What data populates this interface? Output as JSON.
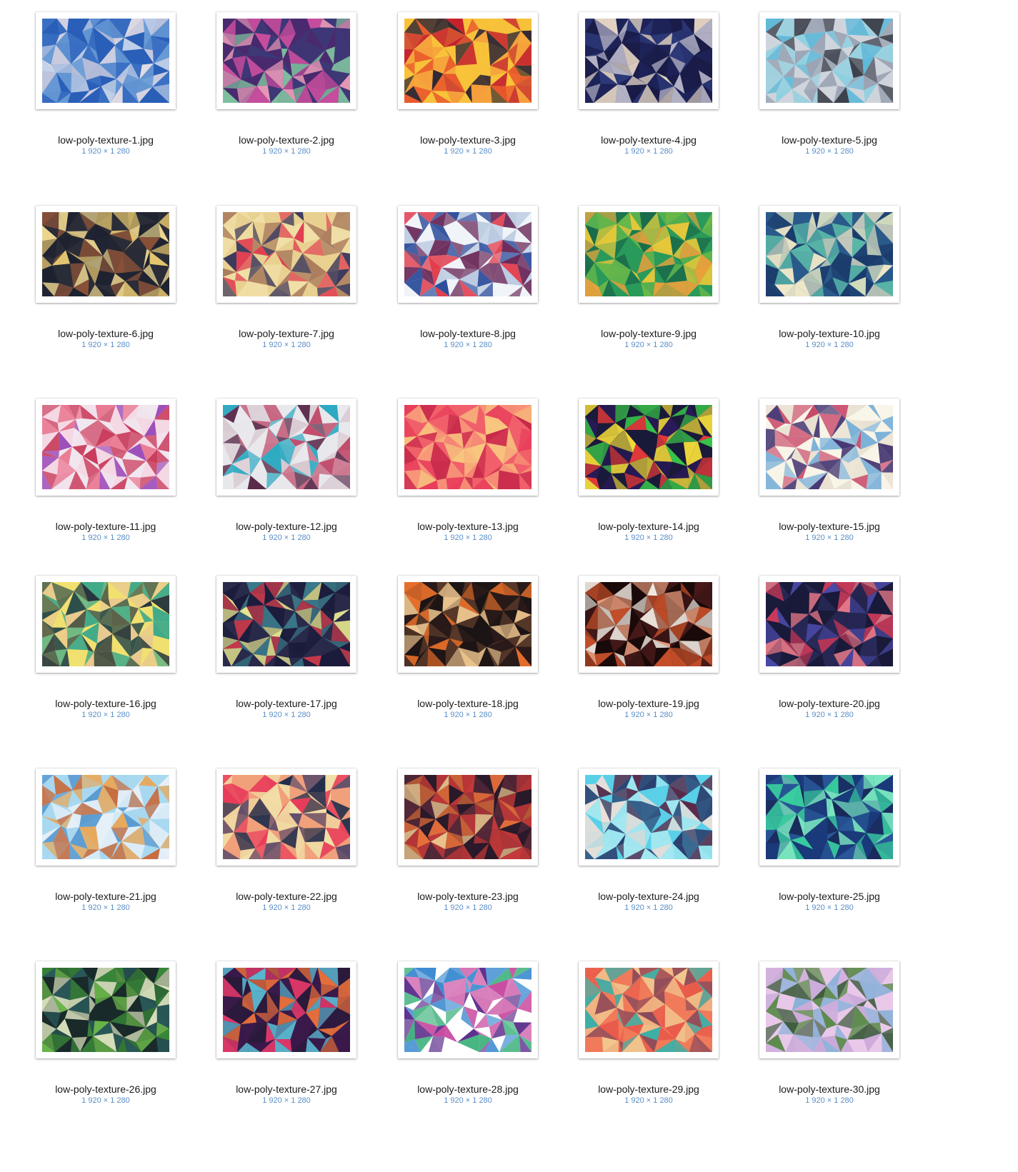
{
  "files": [
    {
      "name": "low-poly-texture-1.jpg",
      "dims": "1 920 × 1 280",
      "palette": [
        "#2a5fb8",
        "#6fa0d8",
        "#c9d7ea",
        "#e8e0e6",
        "#3d72c4"
      ]
    },
    {
      "name": "low-poly-texture-2.jpg",
      "dims": "1 920 × 1 280",
      "palette": [
        "#4a2a6e",
        "#c94f9e",
        "#7fc4a0",
        "#e89bb8",
        "#3b3a78"
      ]
    },
    {
      "name": "low-poly-texture-3.jpg",
      "dims": "1 920 × 1 280",
      "palette": [
        "#f7c23a",
        "#e8502a",
        "#c41f2f",
        "#2e2534",
        "#f59a3c"
      ]
    },
    {
      "name": "low-poly-texture-4.jpg",
      "dims": "1 920 × 1 280",
      "palette": [
        "#1d2358",
        "#2d3a7a",
        "#b8b6c8",
        "#e8d8c4",
        "#1a1b45"
      ]
    },
    {
      "name": "low-poly-texture-5.jpg",
      "dims": "1 920 × 1 280",
      "palette": [
        "#cfd4dc",
        "#3a3f4a",
        "#5fb9d8",
        "#8fd0e0",
        "#9aa3b3"
      ]
    },
    {
      "name": "low-poly-texture-6.jpg",
      "dims": "1 920 × 1 280",
      "palette": [
        "#2a2d38",
        "#e8c870",
        "#8a5238",
        "#1e2230",
        "#f0d890"
      ]
    },
    {
      "name": "low-poly-texture-7.jpg",
      "dims": "1 920 × 1 280",
      "palette": [
        "#e8d090",
        "#33305a",
        "#e03a50",
        "#a87a5c",
        "#f0e0a8"
      ]
    },
    {
      "name": "low-poly-texture-8.jpg",
      "dims": "1 920 × 1 280",
      "palette": [
        "#f0f4f8",
        "#2a4a9a",
        "#b8c8e0",
        "#6a2a5a",
        "#e03a4a"
      ]
    },
    {
      "name": "low-poly-texture-9.jpg",
      "dims": "1 920 × 1 280",
      "palette": [
        "#2a9a5a",
        "#e8c83a",
        "#6ab84a",
        "#1a6a4a",
        "#f0a03a"
      ]
    },
    {
      "name": "low-poly-texture-10.jpg",
      "dims": "1 920 × 1 280",
      "palette": [
        "#2a5a8a",
        "#f0e8c8",
        "#5ab8a8",
        "#1a3a6a",
        "#d8e0c0"
      ]
    },
    {
      "name": "low-poly-texture-11.jpg",
      "dims": "1 920 × 1 280",
      "palette": [
        "#f4d8e4",
        "#c83a5a",
        "#9a4ab8",
        "#f0e8f0",
        "#e8708a"
      ]
    },
    {
      "name": "low-poly-texture-12.jpg",
      "dims": "1 920 × 1 280",
      "palette": [
        "#e8e8ec",
        "#2aa8c0",
        "#5a2a4a",
        "#d8c8d0",
        "#c04a6a"
      ]
    },
    {
      "name": "low-poly-texture-13.jpg",
      "dims": "1 920 × 1 280",
      "palette": [
        "#f0606a",
        "#f8c880",
        "#e83a5a",
        "#f89a7a",
        "#c82a4a"
      ]
    },
    {
      "name": "low-poly-texture-14.jpg",
      "dims": "1 920 × 1 280",
      "palette": [
        "#1a1a3a",
        "#3ac84a",
        "#e83a3a",
        "#f0d83a",
        "#2a1a5a"
      ]
    },
    {
      "name": "low-poly-texture-15.jpg",
      "dims": "1 920 × 1 280",
      "palette": [
        "#f8f4e8",
        "#3a2a6a",
        "#7ab0d8",
        "#c84a6a",
        "#e8e0d0"
      ]
    },
    {
      "name": "low-poly-texture-16.jpg",
      "dims": "1 920 × 1 280",
      "palette": [
        "#f0e070",
        "#1a2a3a",
        "#3aa88a",
        "#e8c890",
        "#2a4a4a"
      ]
    },
    {
      "name": "low-poly-texture-17.jpg",
      "dims": "1 920 × 1 280",
      "palette": [
        "#2a2a4a",
        "#3a7a8a",
        "#e8e890",
        "#c83a4a",
        "#1a1a3a"
      ]
    },
    {
      "name": "low-poly-texture-18.jpg",
      "dims": "1 920 × 1 280",
      "palette": [
        "#2a1a1a",
        "#e8702a",
        "#f0c890",
        "#5a3a2a",
        "#1a1414"
      ]
    },
    {
      "name": "low-poly-texture-19.jpg",
      "dims": "1 920 × 1 280",
      "palette": [
        "#1a0a0a",
        "#f0e8e0",
        "#c8502a",
        "#4a1a1a",
        "#e89a7a"
      ]
    },
    {
      "name": "low-poly-texture-20.jpg",
      "dims": "1 920 × 1 280",
      "palette": [
        "#1a1a3a",
        "#4a4aa8",
        "#e87a8a",
        "#2a2a5a",
        "#c83a5a"
      ]
    },
    {
      "name": "low-poly-texture-21.jpg",
      "dims": "1 920 × 1 280",
      "palette": [
        "#a8d8f0",
        "#e8a85a",
        "#e8f0f8",
        "#5a9ad0",
        "#c86a3a"
      ]
    },
    {
      "name": "low-poly-texture-22.jpg",
      "dims": "1 920 × 1 280",
      "palette": [
        "#f0a07a",
        "#1a2a4a",
        "#f0e0a8",
        "#e83a5a",
        "#5a4a6a"
      ]
    },
    {
      "name": "low-poly-texture-23.jpg",
      "dims": "1 920 × 1 280",
      "palette": [
        "#2a1a2a",
        "#c83a3a",
        "#f0c890",
        "#e8703a",
        "#5a2a3a"
      ]
    },
    {
      "name": "low-poly-texture-24.jpg",
      "dims": "1 920 × 1 280",
      "palette": [
        "#5ad0e8",
        "#2a3a6a",
        "#f0e0d8",
        "#5a2a4a",
        "#a8e8f0"
      ]
    },
    {
      "name": "low-poly-texture-25.jpg",
      "dims": "1 920 × 1 280",
      "palette": [
        "#1a3a7a",
        "#3ad0a0",
        "#2a5a9a",
        "#7ae8c0",
        "#1a2a5a"
      ]
    },
    {
      "name": "low-poly-texture-26.jpg",
      "dims": "1 920 × 1 280",
      "palette": [
        "#1a2a2a",
        "#3a8a3a",
        "#e8f0c8",
        "#2a5a5a",
        "#6ab84a"
      ]
    },
    {
      "name": "low-poly-texture-27.jpg",
      "dims": "1 920 × 1 280",
      "palette": [
        "#3a1a4a",
        "#e8703a",
        "#5ab8d0",
        "#e83a6a",
        "#2a1a3a"
      ]
    },
    {
      "name": "low-poly-texture-28.jpg",
      "dims": "1 920 × 1 280",
      "palette": [
        "#ffffff",
        "#3a8ad0",
        "#5a2a8a",
        "#3ab07a",
        "#c84aa0"
      ]
    },
    {
      "name": "low-poly-texture-29.jpg",
      "dims": "1 920 × 1 280",
      "palette": [
        "#f07a5a",
        "#3ab0a8",
        "#f0c890",
        "#e85a4a",
        "#8a4a5a"
      ]
    },
    {
      "name": "low-poly-texture-30.jpg",
      "dims": "1 920 × 1 280",
      "palette": [
        "#e8c8e8",
        "#8ab0d8",
        "#3a5a3a",
        "#5a8a4a",
        "#c8a8d8"
      ]
    }
  ]
}
